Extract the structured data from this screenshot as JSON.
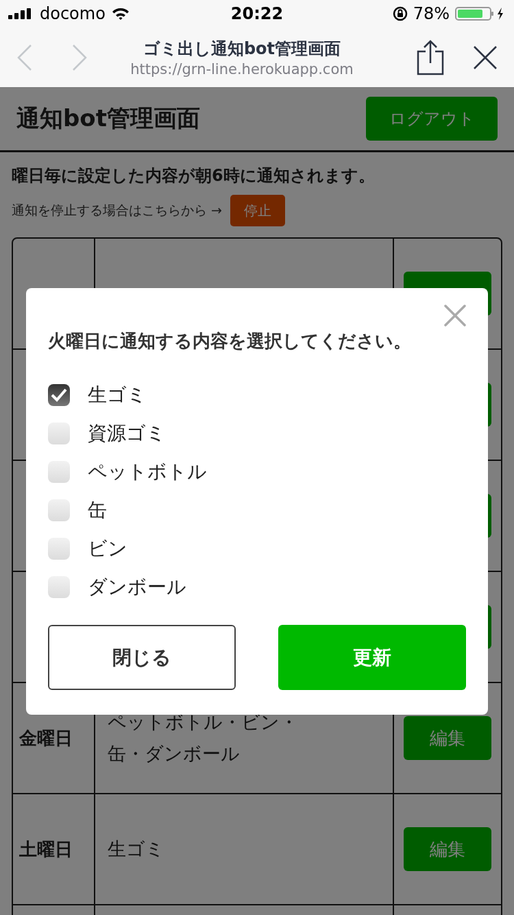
{
  "status_bar": {
    "carrier": "docomo",
    "time": "20:22",
    "battery": "78%"
  },
  "browser": {
    "title": "ゴミ出し通知bot管理画面",
    "url": "https://grn-line.herokuapp.com"
  },
  "header": {
    "title": "通知bot管理画面",
    "logout_button": "ログアウト"
  },
  "notice": "曜日毎に設定した内容が朝6時に通知されます。",
  "stop": {
    "text": "通知を停止する場合はこちらから →",
    "button": "停止"
  },
  "schedule": [
    {
      "kind": "covered"
    },
    {
      "kind": "covered"
    },
    {
      "kind": "covered"
    },
    {
      "kind": "covered"
    },
    {
      "kind": "row",
      "day": "金曜日",
      "content": [
        "ペットボトル・ビン・",
        "缶・ダンボール"
      ],
      "edit_button": "編集"
    },
    {
      "kind": "row",
      "day": "土曜日",
      "content": [
        "生ゴミ"
      ],
      "edit_button": "編集"
    },
    {
      "kind": "blank"
    }
  ],
  "modal": {
    "title": "火曜日に通知する内容を選択してください。",
    "options": [
      {
        "label": "生ゴミ",
        "checked": true
      },
      {
        "label": "資源ゴミ",
        "checked": false
      },
      {
        "label": "ペットボトル",
        "checked": false
      },
      {
        "label": "缶",
        "checked": false
      },
      {
        "label": "ビン",
        "checked": false
      },
      {
        "label": "ダンボール",
        "checked": false
      }
    ],
    "close_button": "閉じる",
    "submit_button": "更新"
  }
}
